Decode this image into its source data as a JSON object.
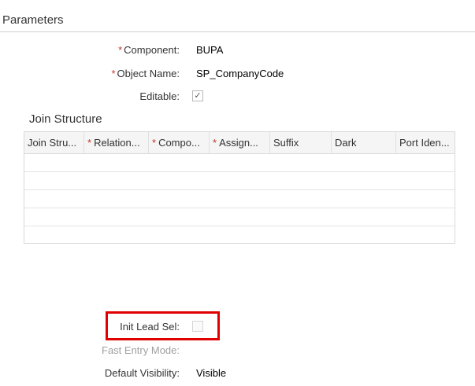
{
  "section": {
    "title": "Parameters"
  },
  "fields": {
    "component": {
      "label": "Component:",
      "value": "BUPA"
    },
    "object_name": {
      "label": "Object Name:",
      "value": "SP_CompanyCode"
    },
    "editable": {
      "label": "Editable:",
      "checked": true,
      "check_mark": "✓"
    },
    "init_lead_sel": {
      "label": "Init Lead Sel:",
      "checked": false
    },
    "fast_entry_mode": {
      "label": "Fast Entry Mode:"
    },
    "default_visibility": {
      "label": "Default Visibility:",
      "value": "Visible"
    }
  },
  "join_structure": {
    "title": "Join Structure",
    "columns": [
      {
        "label": "Join Stru...",
        "required": false
      },
      {
        "label": "Relation...",
        "required": true
      },
      {
        "label": "Compo...",
        "required": true
      },
      {
        "label": "Assign...",
        "required": true
      },
      {
        "label": "Suffix",
        "required": false
      },
      {
        "label": "Dark",
        "required": false
      },
      {
        "label": "Port Iden...",
        "required": false
      }
    ],
    "rows": [
      {},
      {},
      {},
      {},
      {}
    ]
  },
  "required_marker": "*",
  "colors": {
    "required": "#c0392b",
    "highlight": "#e00000"
  }
}
